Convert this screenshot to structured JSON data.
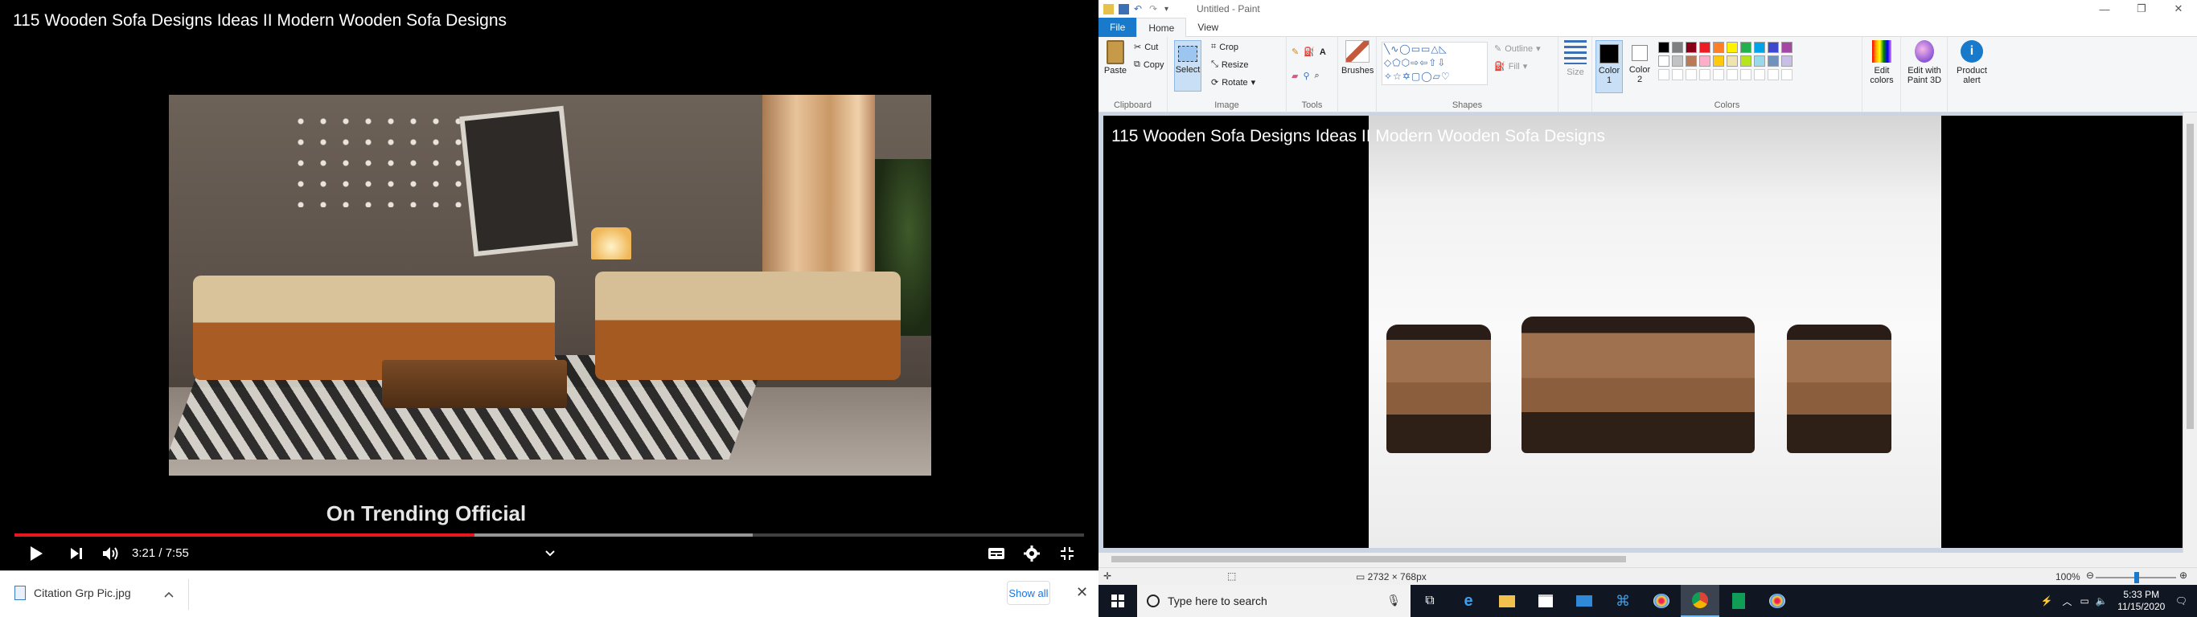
{
  "video": {
    "title": "115 Wooden Sofa Designs Ideas II Modern Wooden Sofa Designs",
    "caption": "On Trending Official",
    "time": "3:21 / 7:55",
    "progress_played": 0.43,
    "progress_buffered": 0.69
  },
  "downloads": {
    "file_name": "Citation Grp Pic.jpg",
    "show_all": "Show all"
  },
  "paint": {
    "window_title": "Untitled - Paint",
    "tabs": [
      "File",
      "Home",
      "View"
    ],
    "clipboard": {
      "paste": "Paste",
      "cut": "Cut",
      "copy": "Copy",
      "label": "Clipboard"
    },
    "image": {
      "select": "Select",
      "crop": "Crop",
      "resize": "Resize",
      "rotate": "Rotate",
      "label": "Image"
    },
    "tools_label": "Tools",
    "brushes": "Brushes",
    "shapes": {
      "outline": "Outline",
      "fill": "Fill",
      "label": "Shapes"
    },
    "size": "Size",
    "color1": "Color 1",
    "color2": "Color 2",
    "colors_label": "Colors",
    "edit_colors": "Edit colors",
    "edit_paint3d": "Edit with Paint 3D",
    "product_alert": "Product alert",
    "palette": [
      "#000000",
      "#7f7f7f",
      "#880015",
      "#ed1c24",
      "#ff7f27",
      "#fff200",
      "#22b14c",
      "#00a2e8",
      "#3f48cc",
      "#a349a4",
      "#ffffff",
      "#c3c3c3",
      "#b97a57",
      "#ffaec9",
      "#ffc90e",
      "#efe4b0",
      "#b5e61d",
      "#99d9ea",
      "#7092be",
      "#c8bfe7"
    ],
    "canvas_title": "115 Wooden Sofa Designs Ideas II Modern Wooden Sofa Designs",
    "status_dims": "2732 × 768px",
    "zoom": "100%"
  },
  "taskbar": {
    "search_placeholder": "Type here to search",
    "time": "5:33 PM",
    "date": "11/15/2020"
  }
}
